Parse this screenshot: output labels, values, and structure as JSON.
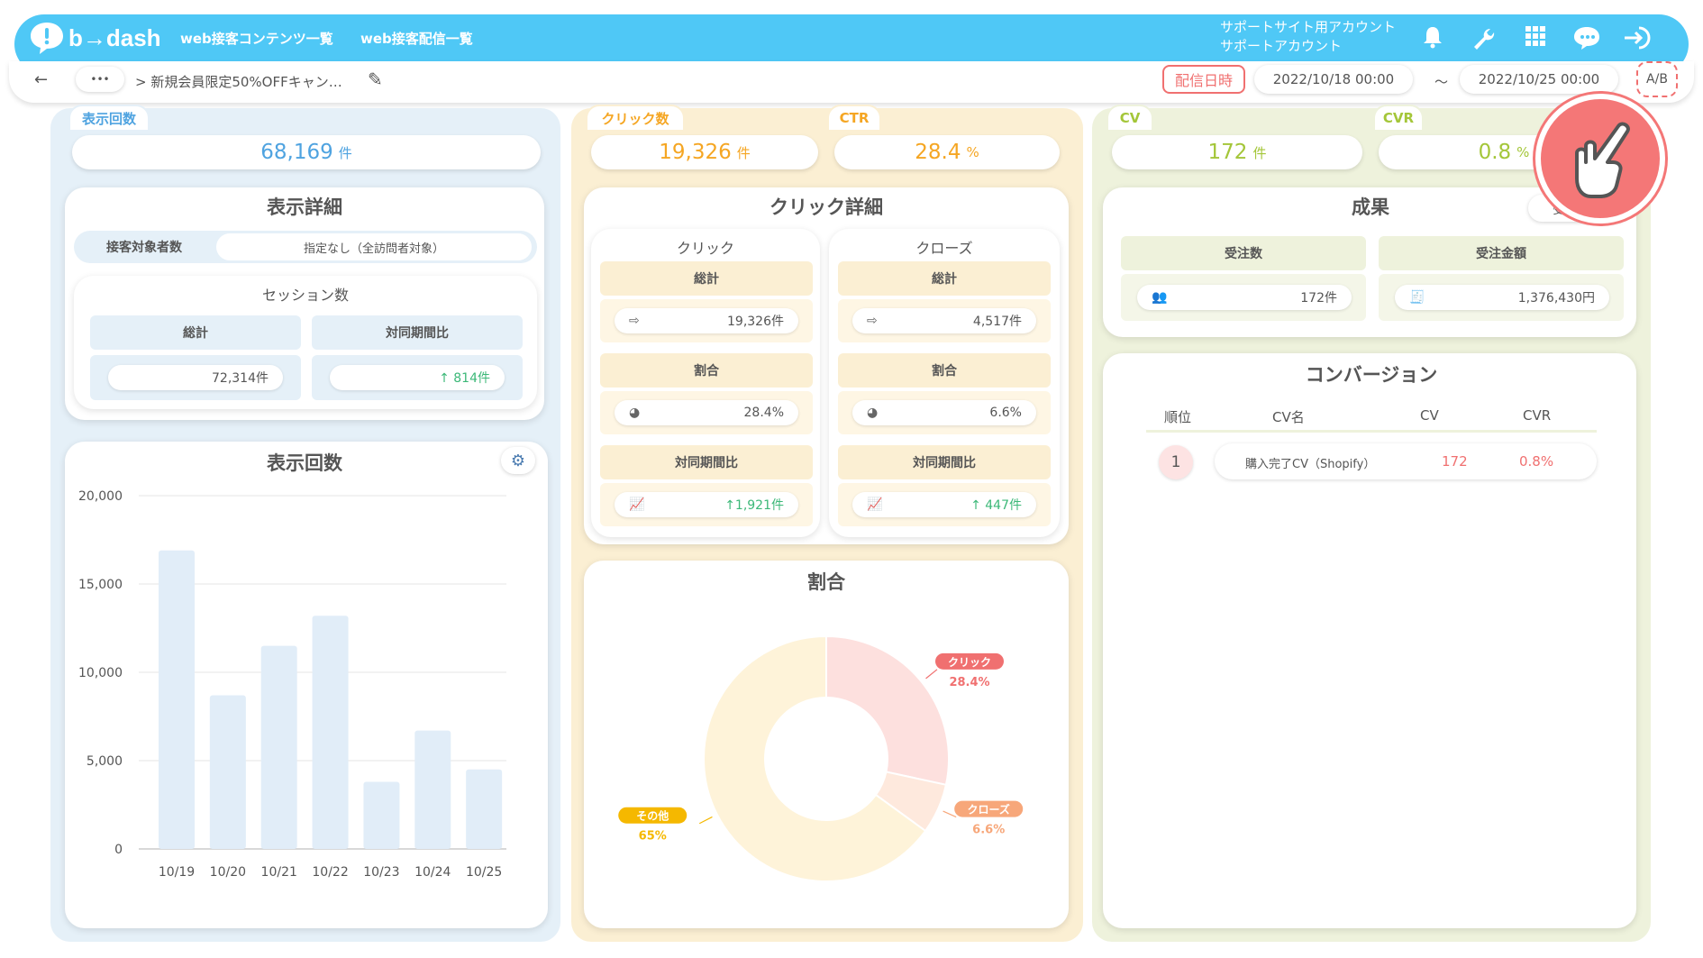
{
  "header": {
    "logo": "b→dash",
    "nav": [
      "web接客コンテンツ一覧",
      "web接客配信一覧"
    ],
    "account_line1": "サポートサイト用アカウント",
    "account_line2": "サポートアカウント",
    "icons": [
      "bell-icon",
      "wrench-icon",
      "grid-icon",
      "chat-icon",
      "logout-icon"
    ]
  },
  "subbar": {
    "back": "←",
    "more": "•••",
    "breadcrumb": "> 新規会員限定50%OFFキャン…",
    "edit": "✎",
    "date_label": "配信日時",
    "date_from": "2022/10/18 00:00",
    "tilde": "～",
    "date_to": "2022/10/25 00:00",
    "ab": "A/B"
  },
  "colors": {
    "blue": "#4fa3e0",
    "orange": "#f5a623",
    "green": "#a4c639",
    "red": "#f07070",
    "pink_light": "#fde3e3",
    "peach": "#ffe4c7",
    "cream": "#fef0d2"
  },
  "stats": {
    "impressions": {
      "label": "表示回数",
      "value": "68,169",
      "unit": "件"
    },
    "clicks": {
      "label": "クリック数",
      "value": "19,326",
      "unit": "件"
    },
    "ctr": {
      "label": "CTR",
      "value": "28.4",
      "unit": "%"
    },
    "cv": {
      "label": "CV",
      "value": "172",
      "unit": "件"
    },
    "cvr": {
      "label": "CVR",
      "value": "0.8",
      "unit": "%"
    }
  },
  "display_detail": {
    "title": "表示詳細",
    "target_label": "接客対象者数",
    "target_value": "指定なし（全訪問者対象）",
    "session_title": "セッション数",
    "total_label": "総計",
    "total_value": "72,314件",
    "yoy_label": "対同期間比",
    "yoy_value": "↑ 814件"
  },
  "impressions_chart": {
    "title": "表示回数",
    "gear": "⚙"
  },
  "click_detail": {
    "title": "クリック詳細",
    "click": {
      "title": "クリック",
      "total_label": "総計",
      "total_value": "19,326件",
      "ratio_label": "割合",
      "ratio_value": "28.4%",
      "yoy_label": "対同期間比",
      "yoy_value": "↑1,921件"
    },
    "close": {
      "title": "クローズ",
      "total_label": "総計",
      "total_value": "4,517件",
      "ratio_label": "割合",
      "ratio_value": "6.6%",
      "yoy_label": "対同期間比",
      "yoy_value": "↑ 447件"
    }
  },
  "ratio_card": {
    "title": "割合",
    "slices": [
      {
        "label": "クリック",
        "pct": "28.4%",
        "value": 28.4,
        "color": "#fde0de",
        "tag_color": "#f07070"
      },
      {
        "label": "クローズ",
        "pct": "6.6%",
        "value": 6.6,
        "color": "#fee9dd",
        "tag_color": "#f7a77a"
      },
      {
        "label": "その他",
        "pct": "65%",
        "value": 65,
        "color": "#fef3d9",
        "tag_color": "#f5b800"
      }
    ]
  },
  "results": {
    "title": "成果",
    "select": "受注",
    "orders_label": "受注数",
    "orders_value": "172件",
    "amount_label": "受注金額",
    "amount_value": "1,376,430円"
  },
  "conversion": {
    "title": "コンバージョン",
    "headers": [
      "順位",
      "CV名",
      "CV",
      "CVR"
    ],
    "rows": [
      {
        "rank": "1",
        "name": "購入完了CV（Shopify）",
        "cv": "172",
        "cvr": "0.8%"
      }
    ]
  },
  "chart_data": {
    "type": "bar",
    "title": "表示回数",
    "categories": [
      "10/19",
      "10/20",
      "10/21",
      "10/22",
      "10/23",
      "10/24",
      "10/25"
    ],
    "values": [
      16900,
      8700,
      11500,
      13200,
      3800,
      6700,
      4500
    ],
    "ylim": [
      0,
      20000
    ],
    "yticks": [
      "0",
      "5,000",
      "10,000",
      "15,000",
      "20,000"
    ],
    "grid": true,
    "bar_color": "#e1edf8"
  }
}
